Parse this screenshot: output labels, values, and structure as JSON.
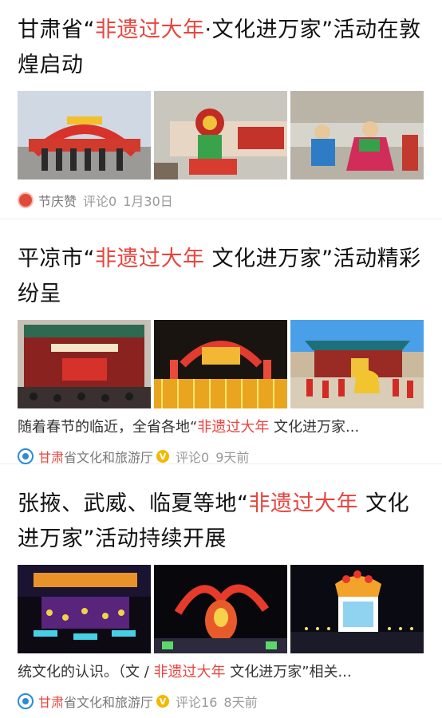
{
  "articles": [
    {
      "title_pre": "甘肃省“",
      "title_hl": "非遗过大年",
      "title_post": "·文化进万家”活动在敦煌启动",
      "source": "节庆赞",
      "comments": "评论0",
      "time": "1月30日"
    },
    {
      "title_pre": "平凉市“",
      "title_hl": "非遗过大年",
      "title_post": " 文化进万家”活动精彩纷呈",
      "snippet_pre": "随着春节的临近，全省各地“",
      "snippet_hl": "非遗过大年",
      "snippet_post": " 文化进万家...",
      "source_hl": "甘肃",
      "source_rest": "省文化和旅游厅",
      "verified_mark": "V",
      "comments": "评论0",
      "time": "9天前"
    },
    {
      "title_pre": "张掖、武威、临夏等地“",
      "title_hl": "非遗过大年",
      "title_post": " 文化进万家”活动持续开展",
      "snippet_pre": "统文化的认识。（文 / ",
      "snippet_hl": "非遗过大年",
      "snippet_post": " 文化进万家”相关...",
      "source_hl": "甘肃",
      "source_rest": "省文化和旅游厅",
      "verified_mark": "V",
      "comments": "评论16",
      "time": "8天前"
    }
  ]
}
